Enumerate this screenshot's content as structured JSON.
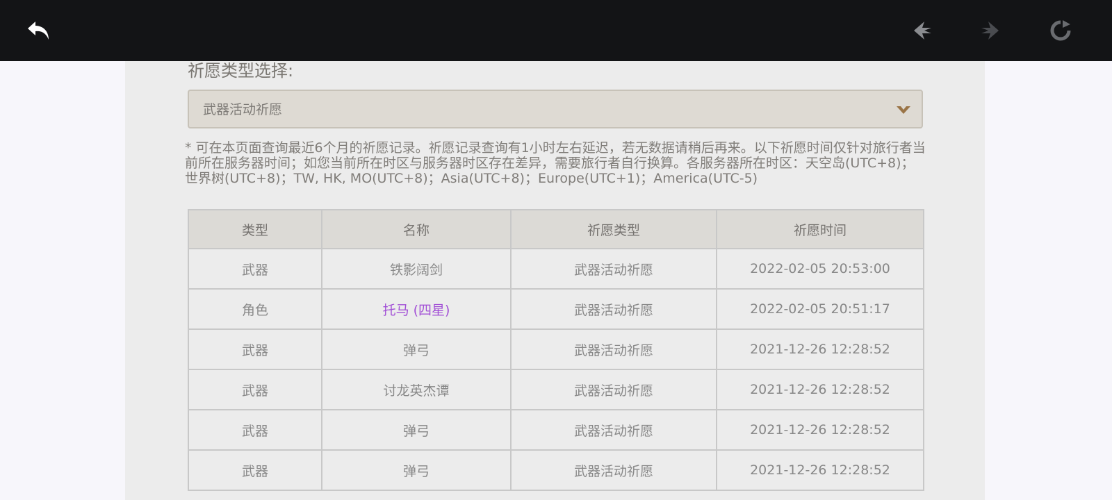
{
  "toolbar": {
    "back_icon": "undo-arrow-icon",
    "prev_icon": "prev-arrow-icon",
    "next_icon": "next-arrow-icon",
    "refresh_icon": "refresh-icon"
  },
  "wish_type": {
    "label": "祈愿类型选择:",
    "selected": "武器活动祈愿"
  },
  "notice": "* 可在本页面查询最近6个月的祈愿记录。祈愿记录查询有1小时左右延迟，若无数据请稍后再来。以下祈愿时间仅针对旅行者当前所在服务器时间；如您当前所在时区与服务器时区存在差异，需要旅行者自行换算。各服务器所在时区：天空岛(UTC+8)；世界树(UTC+8)；TW, HK, MO(UTC+8)；Asia(UTC+8)；Europe(UTC+1)；America(UTC-5)",
  "table": {
    "headers": [
      "类型",
      "名称",
      "祈愿类型",
      "祈愿时间"
    ],
    "rows": [
      [
        "武器",
        "铁影阔剑",
        "武器活动祈愿",
        "2022-02-05 20:53:00"
      ],
      [
        "角色",
        "托马 (四星)",
        "武器活动祈愿",
        "2022-02-05 20:51:17"
      ],
      [
        "武器",
        "弹弓",
        "武器活动祈愿",
        "2021-12-26 12:28:52"
      ],
      [
        "武器",
        "讨龙英杰谭",
        "武器活动祈愿",
        "2021-12-26 12:28:52"
      ],
      [
        "武器",
        "弹弓",
        "武器活动祈愿",
        "2021-12-26 12:28:52"
      ],
      [
        "武器",
        "弹弓",
        "武器活动祈愿",
        "2021-12-26 12:28:52"
      ]
    ]
  },
  "colors": {
    "highlight_name": "#a24fd6",
    "topbar": "#131416"
  }
}
